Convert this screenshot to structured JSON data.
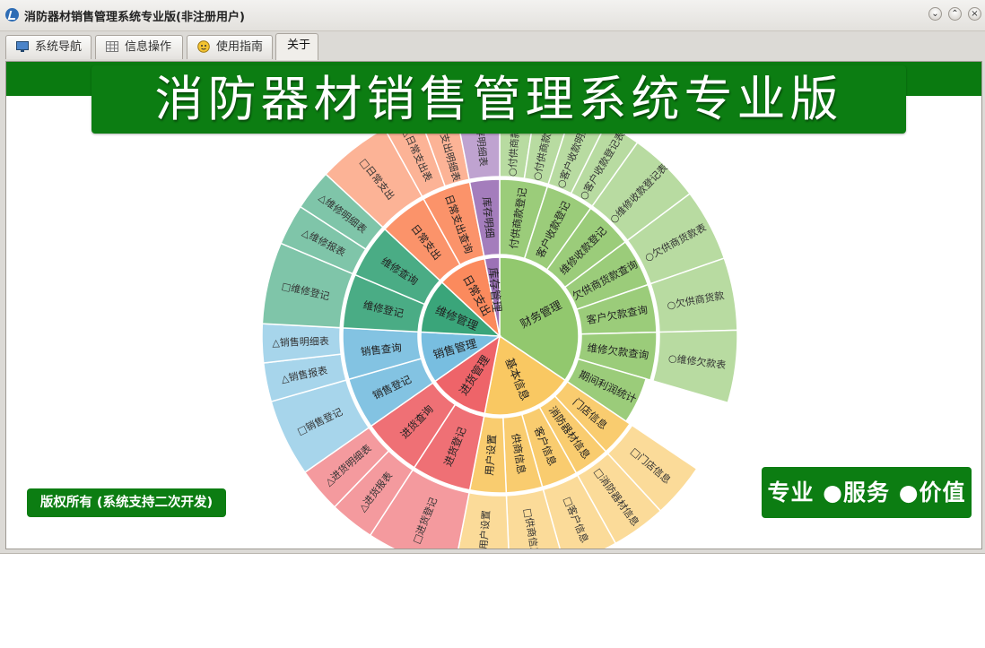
{
  "window": {
    "title": "消防器材销售管理系统专业版(非注册用户)",
    "controls": [
      "⌄",
      "⌃",
      "×"
    ]
  },
  "tabs": [
    {
      "label": "系统导航",
      "icon": "monitor-icon"
    },
    {
      "label": "信息操作",
      "icon": "grid-icon"
    },
    {
      "label": "使用指南",
      "icon": "guide-icon"
    },
    {
      "label": "关于",
      "icon": ""
    }
  ],
  "active_tab": "关于",
  "banner": {
    "title": "消防器材销售管理系统专业版"
  },
  "copyright": "版权所有 (系统支持二次开发)",
  "slogan": "专业 ●服务 ●价值",
  "colors": {
    "brand_green": "#0c7d12",
    "finance": "#92c86e",
    "basic": "#f9c862",
    "purchase": "#ee6469",
    "sales": "#78bee0",
    "repair": "#3aa57a",
    "expense": "#fb8a5d",
    "inventory": "#9c72b6"
  },
  "sunburst": {
    "categories": [
      {
        "name": "财务管理",
        "color": "#92c86e",
        "children": [
          {
            "name": "付供商款登记",
            "leaves": [
              "○付供商款明细表",
              "○付供商款登记表"
            ]
          },
          {
            "name": "客户收款登记",
            "leaves": [
              "○客户收款明细表",
              "○客户收款登记表"
            ]
          },
          {
            "name": "维修收款登记",
            "leaves": [
              "○维修收款登记表"
            ]
          },
          {
            "name": "欠供商货款查询",
            "leaves": [
              "○欠供商货款表"
            ]
          },
          {
            "name": "客户欠款查询",
            "leaves": [
              "○欠供商货款"
            ]
          },
          {
            "name": "维修欠款查询",
            "leaves": [
              "○维修欠款表"
            ]
          },
          {
            "name": "期间利润统计",
            "leaves": []
          }
        ]
      },
      {
        "name": "基本信息",
        "color": "#f9c862",
        "children": [
          {
            "name": "门店信息",
            "leaves": [
              "□门店信息"
            ]
          },
          {
            "name": "消防器材信息",
            "leaves": [
              "□消防器材信息"
            ]
          },
          {
            "name": "客户信息",
            "leaves": [
              "□客户信息"
            ]
          },
          {
            "name": "供商信息",
            "leaves": [
              "□供商信息"
            ]
          },
          {
            "name": "用户设置",
            "leaves": [
              "□用户设置"
            ]
          }
        ]
      },
      {
        "name": "进货管理",
        "color": "#ee6469",
        "children": [
          {
            "name": "进货登记",
            "leaves": [
              "□进货登记"
            ]
          },
          {
            "name": "进货查询",
            "leaves": [
              "△进货报表",
              "△进货明细表"
            ]
          }
        ]
      },
      {
        "name": "销售管理",
        "color": "#78bee0",
        "children": [
          {
            "name": "销售登记",
            "leaves": [
              "□销售登记"
            ]
          },
          {
            "name": "销售查询",
            "leaves": [
              "△销售报表",
              "△销售明细表"
            ]
          }
        ]
      },
      {
        "name": "维修管理",
        "color": "#3aa57a",
        "children": [
          {
            "name": "维修登记",
            "leaves": [
              "□维修登记"
            ]
          },
          {
            "name": "维修查询",
            "leaves": [
              "△维修报表",
              "△维修明细表"
            ]
          }
        ]
      },
      {
        "name": "日常支出",
        "color": "#fb8a5d",
        "children": [
          {
            "name": "日常支出",
            "leaves": [
              "□日常支出"
            ]
          },
          {
            "name": "日常支出查询",
            "leaves": [
              "△日常支出表",
              "△日常支出明细表"
            ]
          }
        ]
      },
      {
        "name": "库存管理",
        "color": "#9c72b6",
        "children": [
          {
            "name": "库存明细",
            "leaves": [
              "△库存明细表"
            ]
          }
        ]
      }
    ]
  }
}
